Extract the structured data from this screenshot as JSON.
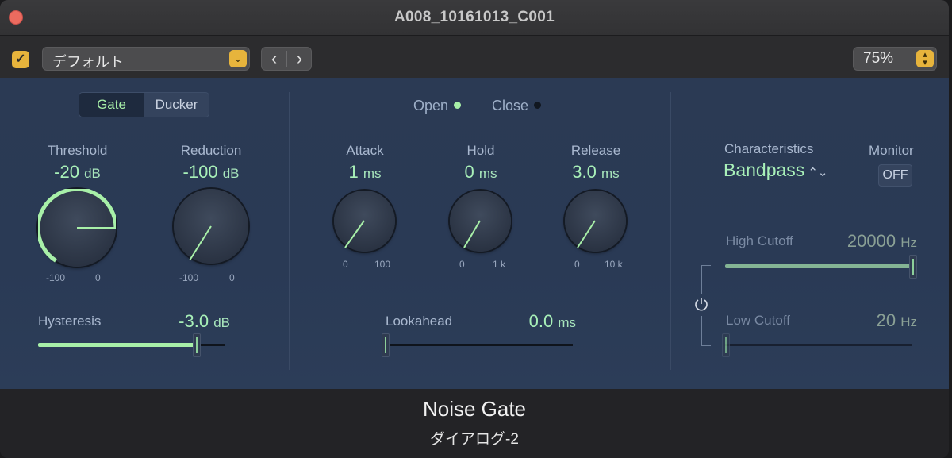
{
  "window": {
    "title": "A008_10161013_C001"
  },
  "toolbar": {
    "enabled": true,
    "preset": "デフォルト",
    "prev_icon": "chevron-left-icon",
    "next_icon": "chevron-right-icon",
    "zoom": "75%"
  },
  "mode": {
    "gate": "Gate",
    "ducker": "Ducker",
    "selected": "Gate"
  },
  "threshold": {
    "label": "Threshold",
    "value": "-20",
    "unit": "dB",
    "min": "-100",
    "max": "0",
    "level": 0.8
  },
  "reduction": {
    "label": "Reduction",
    "value": "-100",
    "unit": "dB",
    "min": "-100",
    "max": "0",
    "level": 0.0
  },
  "hysteresis": {
    "label": "Hysteresis",
    "value": "-3.0",
    "unit": "dB",
    "level": 0.85
  },
  "status": {
    "open": "Open",
    "close": "Close",
    "open_color": "#a8f0a8",
    "close_color": "#111720"
  },
  "attack": {
    "label": "Attack",
    "value": "1",
    "unit": "ms",
    "min": "0",
    "max": "100",
    "level": 0.0
  },
  "hold": {
    "label": "Hold",
    "value": "0",
    "unit": "ms",
    "min": "0",
    "max": "1 k",
    "level": 0.0
  },
  "release": {
    "label": "Release",
    "value": "3.0",
    "unit": "ms",
    "min": "0",
    "max": "10 k",
    "level": 0.0
  },
  "lookahead": {
    "label": "Lookahead",
    "value": "0.0",
    "unit": "ms",
    "level": 0.0
  },
  "characteristics": {
    "label": "Characteristics",
    "value": "Bandpass"
  },
  "monitor": {
    "label": "Monitor",
    "value": "OFF"
  },
  "high_cutoff": {
    "label": "High Cutoff",
    "value": "20000",
    "unit": "Hz",
    "level": 1.0
  },
  "low_cutoff": {
    "label": "Low Cutoff",
    "value": "20",
    "unit": "Hz",
    "level": 0.0
  },
  "footer": {
    "title": "Noise Gate",
    "subtitle": "ダイアログ-2"
  },
  "colors": {
    "accent": "#a8f0a8",
    "panel": "#2b3a54",
    "checkbox": "#e7b43c"
  }
}
